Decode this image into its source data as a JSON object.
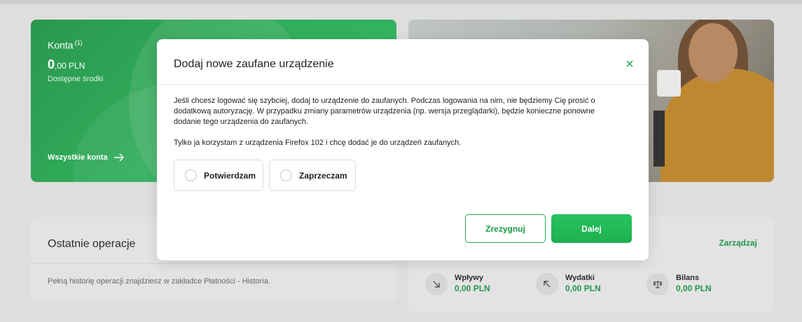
{
  "accounts": {
    "title": "Konta",
    "footnote": "(1)",
    "amount_main": "0",
    "amount_rest": ",00 PLN",
    "subtitle": "Dostępne środki",
    "all_link": "Wszystkie konta"
  },
  "operations": {
    "title": "Ostatnie operacje",
    "info": "Pełną historię operacji znajdziesz w zakładce Płatności - Historia."
  },
  "finance": {
    "manage_label": "Zarządzaj",
    "items": [
      {
        "label": "Wpływy",
        "value": "0,00 PLN",
        "icon": "arrow-down-right-icon"
      },
      {
        "label": "Wydatki",
        "value": "0,00 PLN",
        "icon": "arrow-up-left-icon"
      },
      {
        "label": "Bilans",
        "value": "0,00 PLN",
        "icon": "scale-icon"
      }
    ]
  },
  "modal": {
    "title": "Dodaj nowe zaufane urządzenie",
    "paragraph1": "Jeśli chcesz logować się szybciej, dodaj to urządzenie do zaufanych. Podczas logowania na nim, nie będziemy Cię prosić o dodatkową autoryzację. W przypadku zmiany parametrów urządzenia (np. wersja przeglądarki), będzie konieczne ponowne dodanie tego urządzenia do zaufanych.",
    "paragraph2": "Tylko ja korzystam z urządzenia Firefox 102 i chcę dodać je do urządzeń zaufanych.",
    "option_confirm": "Potwierdzam",
    "option_deny": "Zaprzeczam",
    "cancel_label": "Zrezygnuj",
    "next_label": "Dalej"
  },
  "colors": {
    "brand_green": "#1fae50",
    "text_green": "#169c45"
  }
}
